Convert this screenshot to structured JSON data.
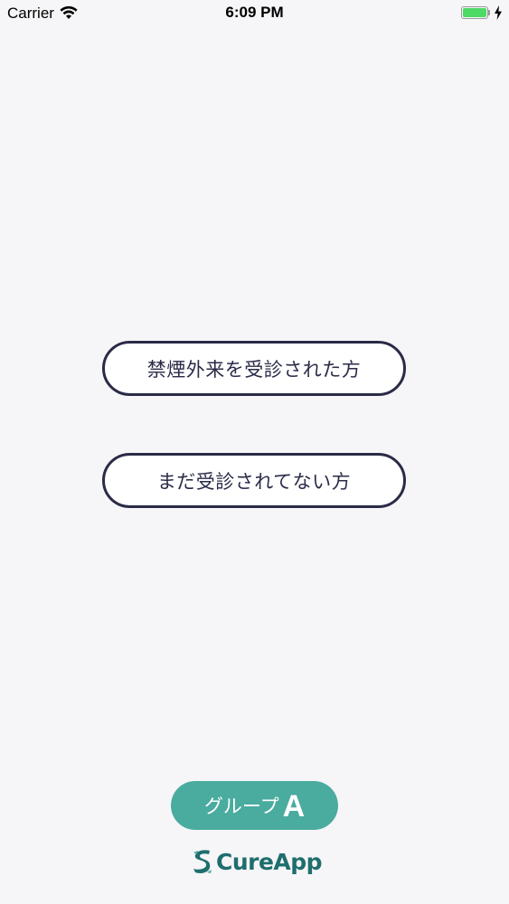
{
  "status_bar": {
    "carrier": "Carrier",
    "time": "6:09 PM",
    "battery_color": "#4cd964",
    "icons": [
      "wifi-icon",
      "battery-icon",
      "charging-bolt-icon"
    ]
  },
  "choices": {
    "visited_label": "禁煙外来を受診された方",
    "not_visited_label": "まだ受診されてない方"
  },
  "group_badge": {
    "label": "グループ",
    "letter": "A",
    "color": "#4aab9f"
  },
  "logo": {
    "text": "CureApp",
    "color": "#1f6e6e",
    "icon": "cureapp-logo-icon"
  },
  "colors": {
    "background": "#f6f5f7",
    "button_border": "#2a2b47",
    "button_text": "#2a2b47"
  }
}
